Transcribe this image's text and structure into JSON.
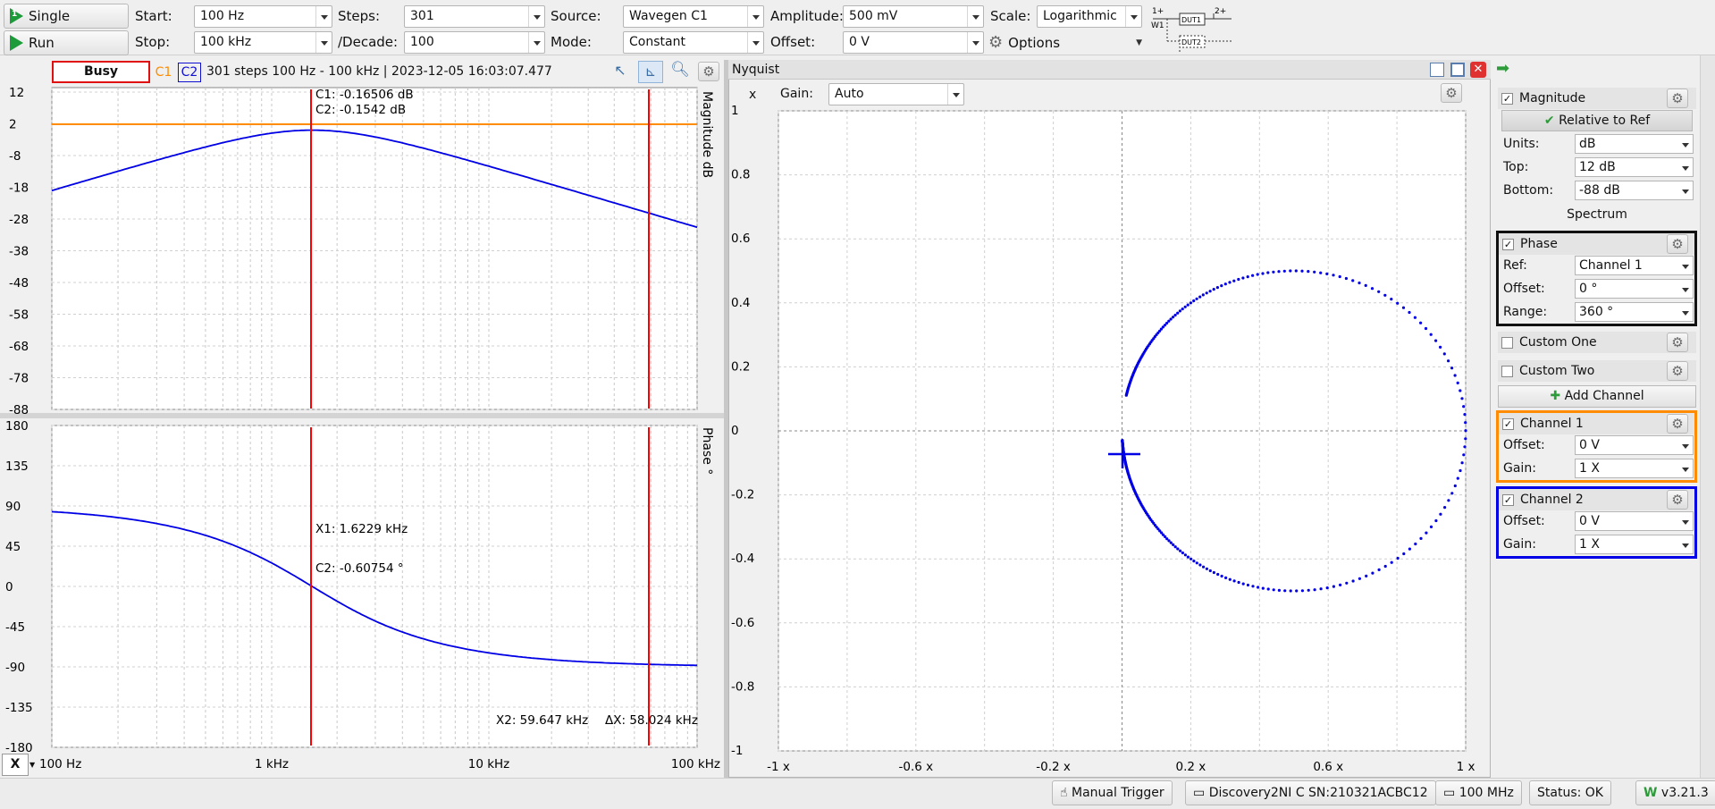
{
  "toolbar": {
    "single_label": "Single",
    "run_label": "Run",
    "start_label": "Start:",
    "start_value": "100 Hz",
    "stop_label": "Stop:",
    "stop_value": "100 kHz",
    "steps_label": "Steps:",
    "steps_value": "301",
    "decade_label": "/Decade:",
    "decade_value": "100",
    "source_label": "Source:",
    "source_value": "Wavegen C1",
    "mode_label": "Mode:",
    "mode_value": "Constant",
    "amplitude_label": "Amplitude:",
    "amplitude_value": "500 mV",
    "offset_label": "Offset:",
    "offset_value": "0 V",
    "scale_label": "Scale:",
    "scale_value": "Logarithmic",
    "options_label": "Options",
    "diagram": {
      "top_left": "1+",
      "top_right": "2+",
      "w1": "W1",
      "dut1": "DUT1",
      "dut2": "DUT2"
    }
  },
  "plot_header": {
    "busy": "Busy",
    "c1": "C1",
    "c2": "C2",
    "info": "301 steps  100 Hz - 100 kHz | 2023-12-05 16:03:07.477"
  },
  "magnitude_plot": {
    "ylabel": "Magnitude  dB",
    "yticks": [
      "12",
      "2",
      "-8",
      "-18",
      "-28",
      "-38",
      "-48",
      "-58",
      "-68",
      "-78",
      "-88"
    ],
    "cursor_c1": "C1: -0.16506 dB",
    "cursor_c2": "C2: -0.1542 dB"
  },
  "phase_plot": {
    "ylabel": "Phase  °",
    "yticks": [
      "180",
      "135",
      "90",
      "45",
      "0",
      "-45",
      "-90",
      "-135",
      "-180"
    ],
    "x1": "X1: 1.6229 kHz",
    "c2": "C2: -0.60754 °",
    "x2": "X2: 59.647 kHz",
    "dx": "ΔX: 58.024 kHz"
  },
  "x_axis": {
    "ticks": [
      "100 Hz",
      "1 kHz",
      "10 kHz",
      "100 kHz"
    ],
    "mode": "X"
  },
  "nyquist": {
    "title": "Nyquist",
    "x_label": "x",
    "gain_label": "Gain:",
    "gain_value": "Auto",
    "yticks": [
      "1",
      "0.8",
      "0.6",
      "0.4",
      "0.2",
      "0",
      "-0.2",
      "-0.4",
      "-0.6",
      "-0.8",
      "-1"
    ],
    "xticks": [
      "-1 x",
      "-0.6 x",
      "-0.2 x",
      "0.2 x",
      "0.6 x",
      "1 x"
    ]
  },
  "right_panel": {
    "magnitude": {
      "title": "Magnitude",
      "relative": "Relative to Ref",
      "units_label": "Units:",
      "units": "dB",
      "top_label": "Top:",
      "top": "12 dB",
      "bottom_label": "Bottom:",
      "bottom": "-88 dB",
      "spectrum": "Spectrum"
    },
    "phase": {
      "title": "Phase",
      "ref_label": "Ref:",
      "ref": "Channel 1",
      "offset_label": "Offset:",
      "offset": "0 °",
      "range_label": "Range:",
      "range": "360 °"
    },
    "custom_one": "Custom One",
    "custom_two": "Custom Two",
    "add_channel": "Add Channel",
    "channel1": {
      "title": "Channel 1",
      "offset_label": "Offset:",
      "offset": "0 V",
      "gain_label": "Gain:",
      "gain": "1 X"
    },
    "channel2": {
      "title": "Channel 2",
      "offset_label": "Offset:",
      "offset": "0 V",
      "gain_label": "Gain:",
      "gain": "1 X"
    }
  },
  "statusbar": {
    "trigger": "Manual Trigger",
    "device": "Discovery2NI C SN:210321ACBC12",
    "clock": "100 MHz",
    "status": "Status: OK",
    "version": "v3.21.3"
  },
  "colors": {
    "c1": "#ff8c00",
    "c2": "#0000e6",
    "cursor": "#ff0000"
  }
}
